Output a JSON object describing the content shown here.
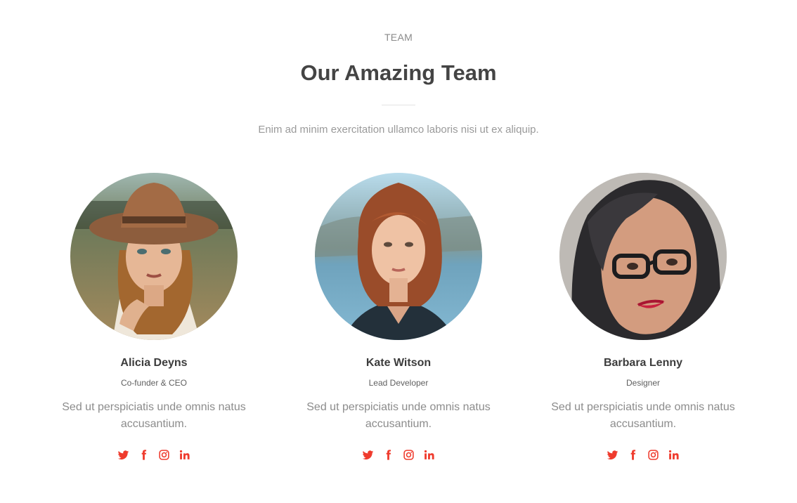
{
  "header": {
    "tag": "TEAM",
    "title": "Our Amazing Team",
    "subtitle": "Enim ad minim exercitation ullamco laboris nisi ut ex aliquip."
  },
  "colors": {
    "accent": "#ef3b2d",
    "heading": "#444444",
    "muted": "#8c8c8c"
  },
  "members": [
    {
      "name": "Alicia Deyns",
      "role": "Co-funder & CEO",
      "bio": "Sed ut perspiciatis unde omnis natus accusantium.",
      "socials": [
        "twitter-icon",
        "facebook-icon",
        "instagram-icon",
        "linkedin-icon"
      ]
    },
    {
      "name": "Kate Witson",
      "role": "Lead Developer",
      "bio": "Sed ut perspiciatis unde omnis natus accusantium.",
      "socials": [
        "twitter-icon",
        "facebook-icon",
        "instagram-icon",
        "linkedin-icon"
      ]
    },
    {
      "name": "Barbara Lenny",
      "role": "Designer",
      "bio": "Sed ut perspiciatis unde omnis natus accusantium.",
      "socials": [
        "twitter-icon",
        "facebook-icon",
        "instagram-icon",
        "linkedin-icon"
      ]
    }
  ]
}
